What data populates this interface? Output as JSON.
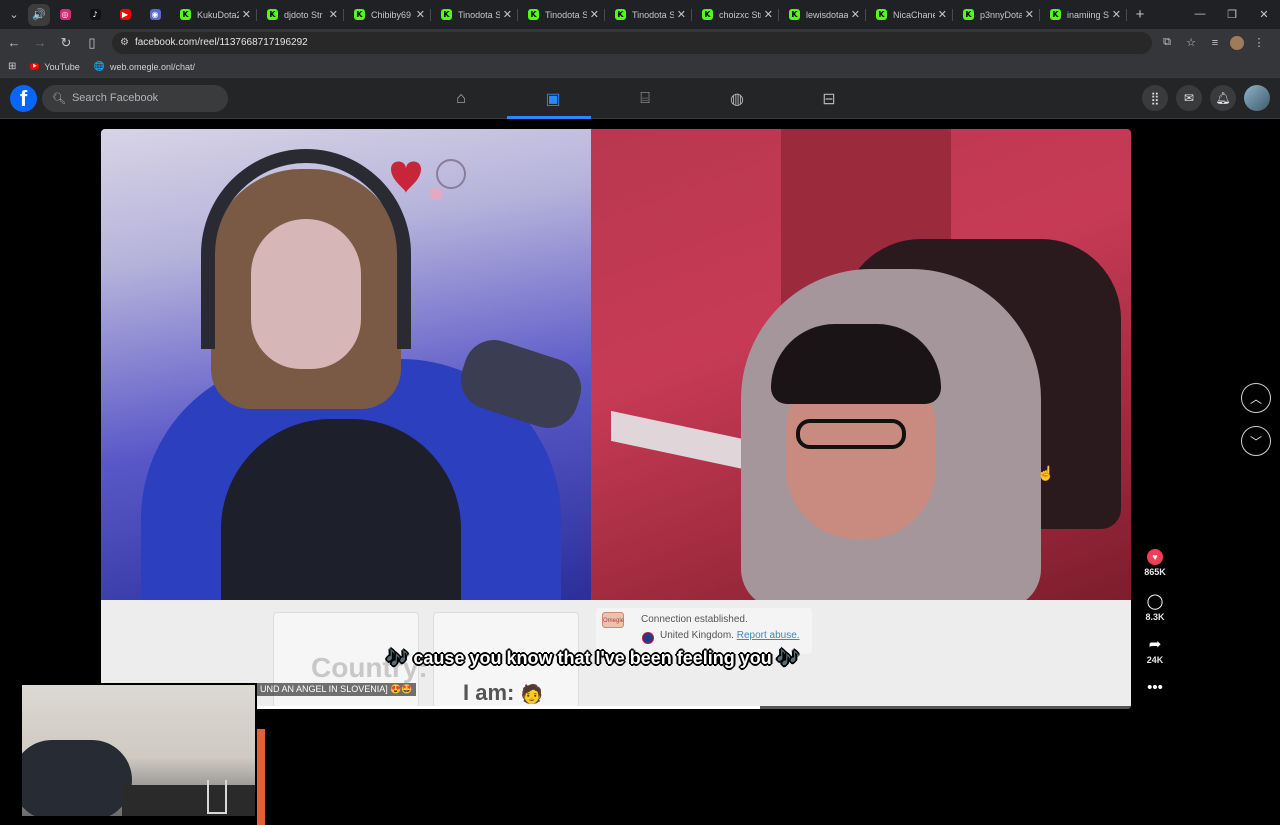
{
  "browser": {
    "tabs": [
      {
        "title": "KukuDota2",
        "favicon": "K",
        "color": "#53fc18"
      },
      {
        "title": "djdoto Str",
        "favicon": "K",
        "color": "#53fc18"
      },
      {
        "title": "Chibiby69",
        "favicon": "K",
        "color": "#53fc18"
      },
      {
        "title": "Tinodota S",
        "favicon": "K",
        "color": "#53fc18"
      },
      {
        "title": "Tinodota S",
        "favicon": "K",
        "color": "#53fc18"
      },
      {
        "title": "Tinodota S",
        "favicon": "K",
        "color": "#53fc18"
      },
      {
        "title": "choizxc Str",
        "favicon": "K",
        "color": "#53fc18"
      },
      {
        "title": "lewisdotaa",
        "favicon": "K",
        "color": "#53fc18"
      },
      {
        "title": "NicaChane",
        "favicon": "K",
        "color": "#53fc18"
      },
      {
        "title": "p3nnyDota",
        "favicon": "K",
        "color": "#53fc18"
      },
      {
        "title": "inamiing S",
        "favicon": "K",
        "color": "#53fc18"
      }
    ],
    "url": "facebook.com/reel/1137668717196292",
    "bookmarks": [
      {
        "label": "YouTube",
        "icon": "youtube-icon"
      },
      {
        "label": "web.omegle.onl/chat/",
        "icon": "globe-icon"
      }
    ]
  },
  "facebook": {
    "search_placeholder": "Search Facebook",
    "nav": [
      "home-icon",
      "video-icon",
      "marketplace-icon",
      "groups-icon",
      "gaming-icon"
    ],
    "accent": "#2d88ff"
  },
  "video": {
    "notification": {
      "line1": "Connection established.",
      "country": "United Kingdom.",
      "report": "Report abuse."
    },
    "country_label": "Country:",
    "iam_label": "I am:",
    "caption": "🎶 cause you know that I've been feeling you 🎶",
    "ticker": "UND AN ANGEL IN SLOVENIA] 😍🤩",
    "progress": 0.64
  },
  "reel_actions": {
    "likes": "865K",
    "comments": "8.3K",
    "shares": "24K"
  }
}
